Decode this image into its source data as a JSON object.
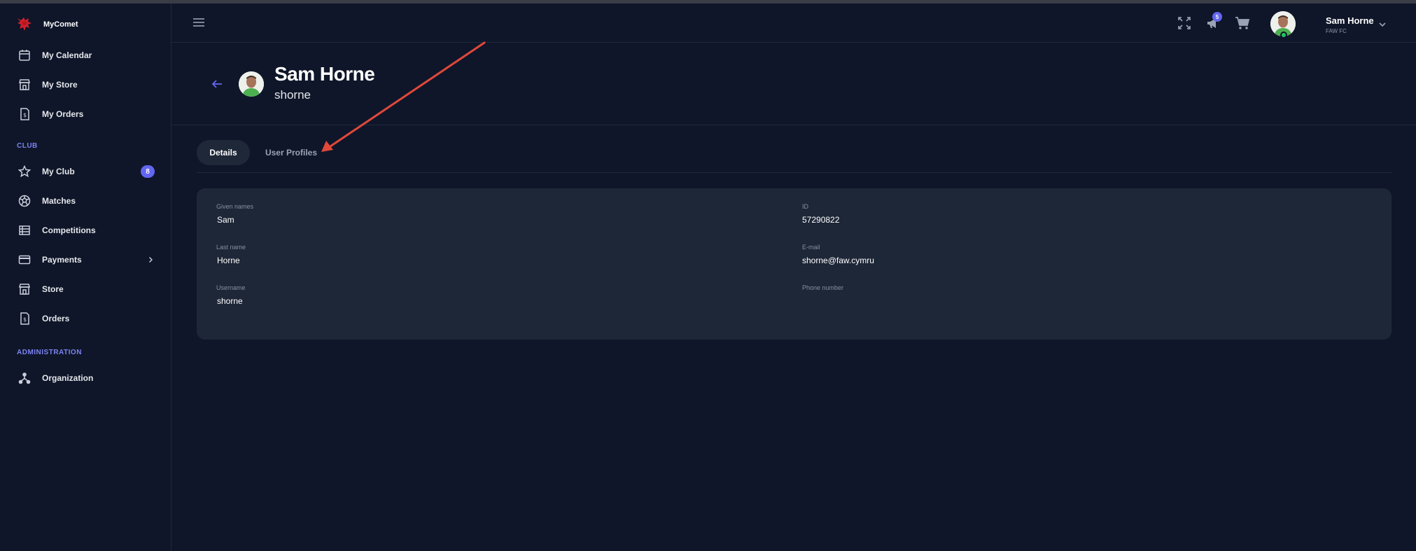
{
  "app": {
    "name": "MyComet"
  },
  "sidebar": {
    "items_top": [
      {
        "label": "My Calendar",
        "icon": "calendar-icon"
      },
      {
        "label": "My Store",
        "icon": "store-icon"
      },
      {
        "label": "My Orders",
        "icon": "receipt-icon"
      }
    ],
    "club_section": "CLUB",
    "club_items": [
      {
        "label": "My Club",
        "icon": "star-icon",
        "badge": "8"
      },
      {
        "label": "Matches",
        "icon": "soccer-ball-icon"
      },
      {
        "label": "Competitions",
        "icon": "table-icon"
      },
      {
        "label": "Payments",
        "icon": "credit-card-icon"
      },
      {
        "label": "Store",
        "icon": "store-icon"
      },
      {
        "label": "Orders",
        "icon": "receipt-icon"
      }
    ],
    "admin_section": "ADMINISTRATION",
    "admin_items": [
      {
        "label": "Organization",
        "icon": "hierarchy-icon"
      }
    ]
  },
  "header": {
    "notifications_count": "5",
    "user": {
      "name": "Sam Horne",
      "org": "FAW FC"
    }
  },
  "profile": {
    "name": "Sam Horne",
    "username": "shorne"
  },
  "tabs": [
    {
      "label": "Details",
      "active": true
    },
    {
      "label": "User Profiles",
      "active": false
    }
  ],
  "details": {
    "given_names_label": "Given names",
    "given_names": "Sam",
    "last_name_label": "Last name",
    "last_name": "Horne",
    "username_label": "Username",
    "username": "shorne",
    "id_label": "ID",
    "id": "57290822",
    "email_label": "E-mail",
    "email": "shorne@faw.cymru",
    "phone_label": "Phone number",
    "phone": ""
  },
  "colors": {
    "background": "#0f1629",
    "card": "#1e2738",
    "accent": "#6366f1",
    "annotation_arrow": "#e0483a"
  }
}
